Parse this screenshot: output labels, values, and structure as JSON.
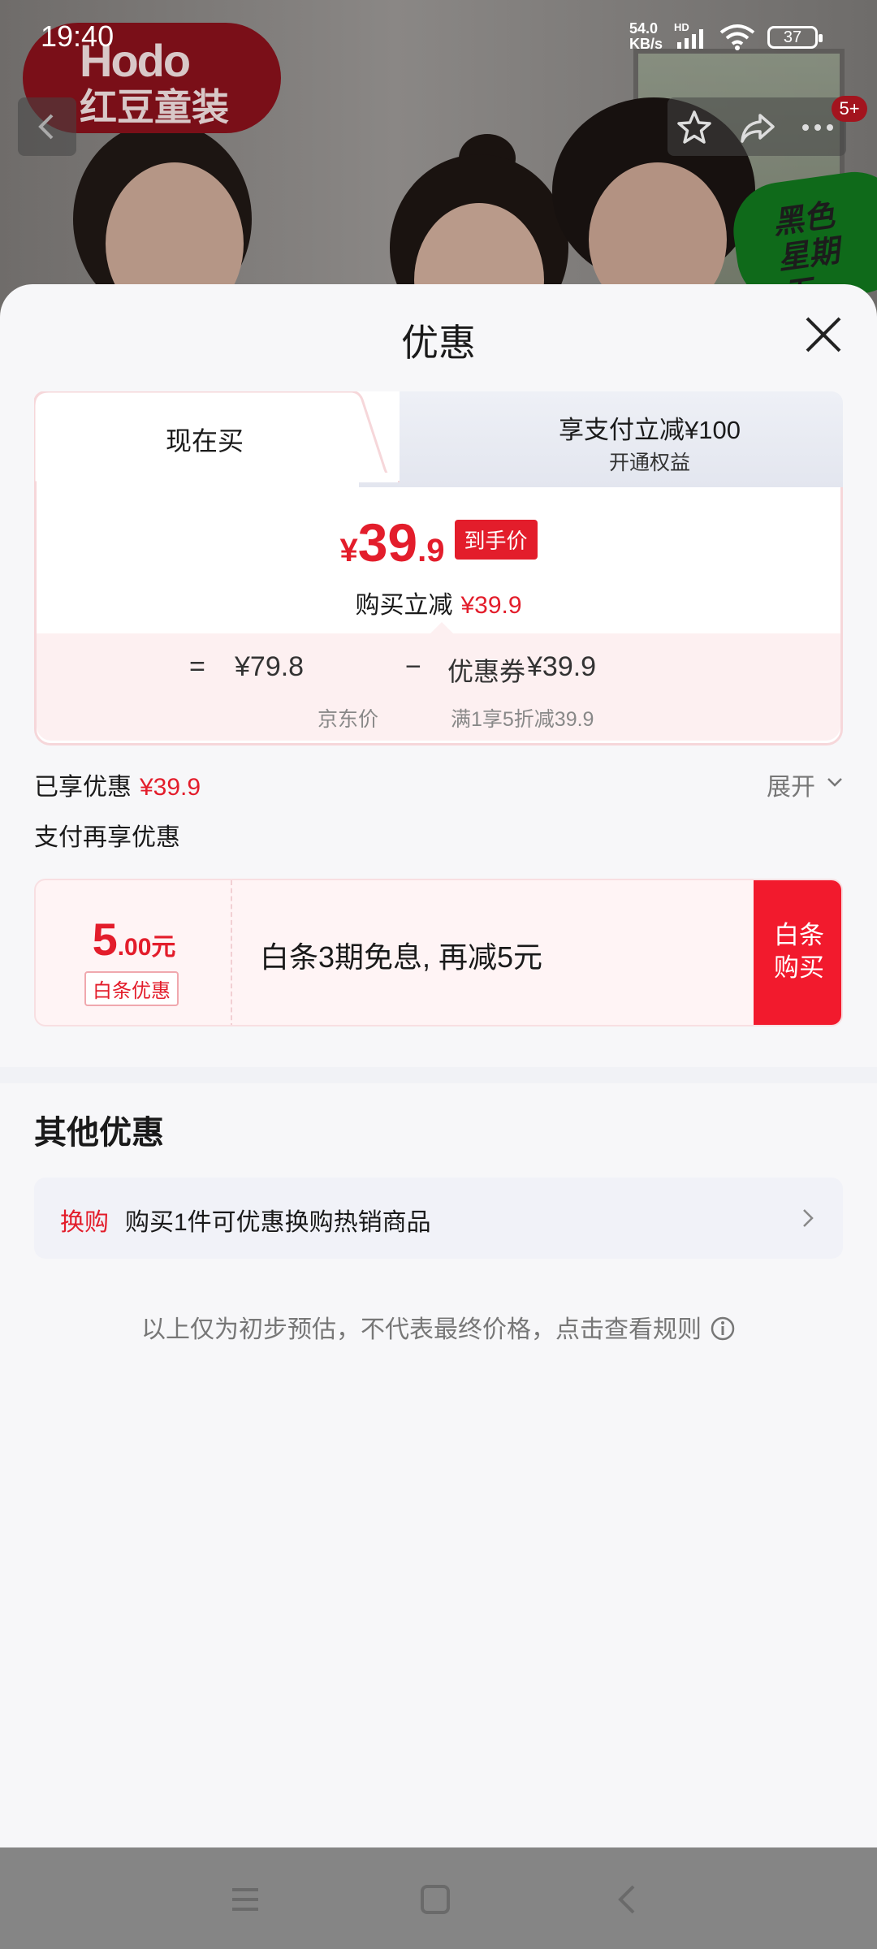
{
  "status_bar": {
    "time": "19:40",
    "network_speed_value": "54.0",
    "network_speed_unit": "KB/s",
    "network_type": "HD",
    "battery": "37"
  },
  "background": {
    "brand_line1": "Hodo",
    "brand_line2": "红豆童装",
    "promo": "黑色星期五",
    "notification_count": "5+"
  },
  "sheet": {
    "title": "优惠",
    "tabs": [
      {
        "label": "现在买"
      },
      {
        "label": "享支付立减¥100",
        "sublabel": "开通权益"
      }
    ],
    "price": {
      "currency": "¥",
      "integer": "39",
      "decimal": ".9",
      "tag": "到手价"
    },
    "savings": {
      "label": "购买立减",
      "value": "¥39.9"
    },
    "breakdown": {
      "equals": "=",
      "base_price": "¥79.8",
      "base_label": "京东价",
      "minus": "−",
      "coupon_name": "优惠券",
      "coupon_value": "¥39.9",
      "coupon_desc": "满1享5折减39.9"
    },
    "enjoyed_label": "已享优惠",
    "enjoyed_value": "¥39.9",
    "expand_label": "展开",
    "pay_more_title": "支付再享优惠",
    "baitiao": {
      "amount_int": "5",
      "amount_dec": ".00元",
      "tag": "白条优惠",
      "description": "白条3期免息, 再减5元",
      "button_line1": "白条",
      "button_line2": "购买"
    },
    "other_title": "其他优惠",
    "swap": {
      "tag": "换购",
      "text": "购买1件可优惠换购热销商品"
    },
    "notice": "以上仅为初步预估，不代表最终价格，点击查看规则"
  },
  "colors": {
    "accent_red": "#e31d2b",
    "button_red": "#f21a2d"
  }
}
